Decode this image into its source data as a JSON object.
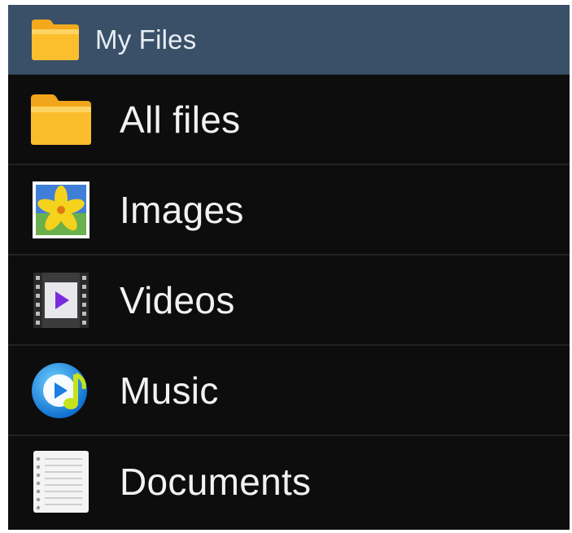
{
  "header": {
    "title": "My Files",
    "icon": "folder-icon"
  },
  "items": [
    {
      "label": "All files",
      "icon": "folder-icon"
    },
    {
      "label": "Images",
      "icon": "image-icon"
    },
    {
      "label": "Videos",
      "icon": "video-icon"
    },
    {
      "label": "Music",
      "icon": "music-icon"
    },
    {
      "label": "Documents",
      "icon": "document-icon"
    }
  ],
  "colors": {
    "header_bg": "#3a5068",
    "list_bg": "#0d0d0d",
    "divider": "#232323",
    "folder": "#f7b924"
  }
}
